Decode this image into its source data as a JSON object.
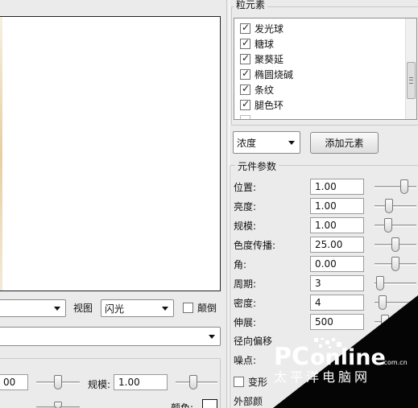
{
  "panel_right": {
    "elements_group_title": "粒元素",
    "elements_list": [
      {
        "label": "发光球",
        "checked": true
      },
      {
        "label": "糖球",
        "checked": true
      },
      {
        "label": "聚葵延",
        "checked": true
      },
      {
        "label": "椭圆烧碱",
        "checked": true
      },
      {
        "label": "条纹",
        "checked": true
      },
      {
        "label": "腿色环",
        "checked": true
      }
    ],
    "mode_select_value": "浓度",
    "add_button_label": "添加元素",
    "params_group_title": "元件参数",
    "params": [
      {
        "label": "位置:",
        "value": "1.00",
        "level": 0.76
      },
      {
        "label": "亮度:",
        "value": "1.00",
        "level": 0.3
      },
      {
        "label": "规模:",
        "value": "1.00",
        "level": 0.28
      },
      {
        "label": "色度传播:",
        "value": "25.00",
        "level": 0.5
      },
      {
        "label": "角:",
        "value": "0.00",
        "level": 0.5
      },
      {
        "label": "周期:",
        "value": "3",
        "level": 0.05
      },
      {
        "label": "密度:",
        "value": "4",
        "level": 0.12
      },
      {
        "label": "伸展:",
        "value": "500",
        "level": 0.2
      }
    ],
    "radial_offset_label": "径向偏移",
    "noise_label": "噪点:",
    "transform_label": "变形",
    "transform_checked": false,
    "external_color_label": "外部颜"
  },
  "panel_left": {
    "view_label": "视图",
    "view_select_value": "闪光",
    "invert_label": "颠倒",
    "invert_checked": false,
    "field_a_value": "00",
    "scale_label": "规模:",
    "scale_value": "1.00",
    "color_label": "颜色:"
  },
  "watermark": {
    "brand_prefix": "PC",
    "brand_main": "online",
    "brand_domain": ".com.cn",
    "brand_cn": "太平洋电脑网"
  }
}
